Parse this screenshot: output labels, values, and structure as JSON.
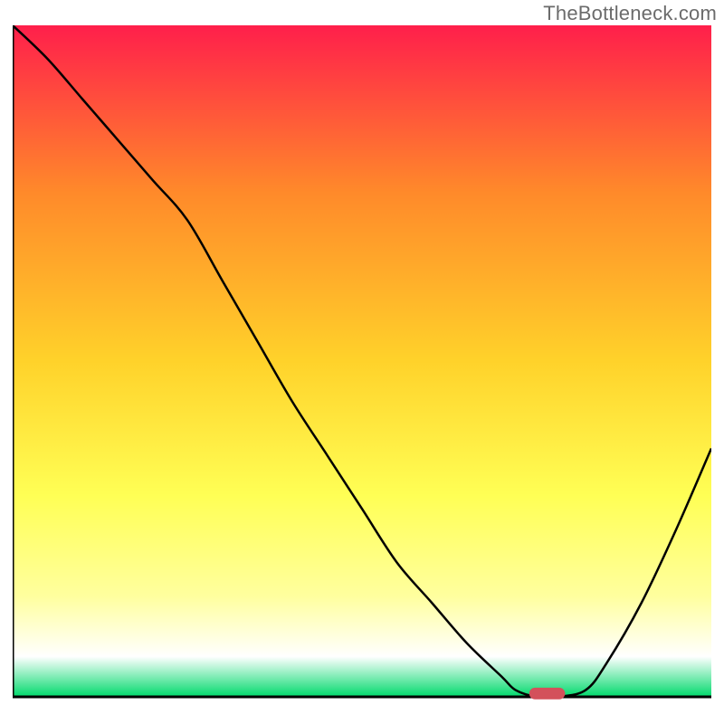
{
  "watermark": "TheBottleneck.com",
  "colors": {
    "gradient_top": "#ff1f4b",
    "gradient_mid1": "#ff8a2a",
    "gradient_mid2": "#ffd22a",
    "gradient_mid3": "#ffff55",
    "gradient_mid4": "#ffff9e",
    "gradient_bottom_pale": "#ffffff",
    "gradient_bottom_green": "#00d96b",
    "axis": "#000000",
    "curve": "#000000",
    "marker_fill": "#d3515b",
    "marker_stroke": "#d3515b"
  },
  "chart_data": {
    "type": "line",
    "title": "",
    "xlabel": "",
    "ylabel": "",
    "xlim": [
      0,
      100
    ],
    "ylim": [
      0,
      100
    ],
    "x": [
      0,
      5,
      10,
      15,
      20,
      25,
      30,
      35,
      40,
      45,
      50,
      55,
      60,
      65,
      70,
      72,
      75,
      78,
      82,
      85,
      90,
      95,
      100
    ],
    "y": [
      100,
      95,
      89,
      83,
      77,
      71,
      62,
      53,
      44,
      36,
      28,
      20,
      14,
      8,
      3,
      1,
      0,
      0,
      1,
      5,
      14,
      25,
      37
    ],
    "marker": {
      "x": 76.5,
      "y": 0.5,
      "width": 5,
      "height": 1.6
    },
    "annotations": []
  }
}
